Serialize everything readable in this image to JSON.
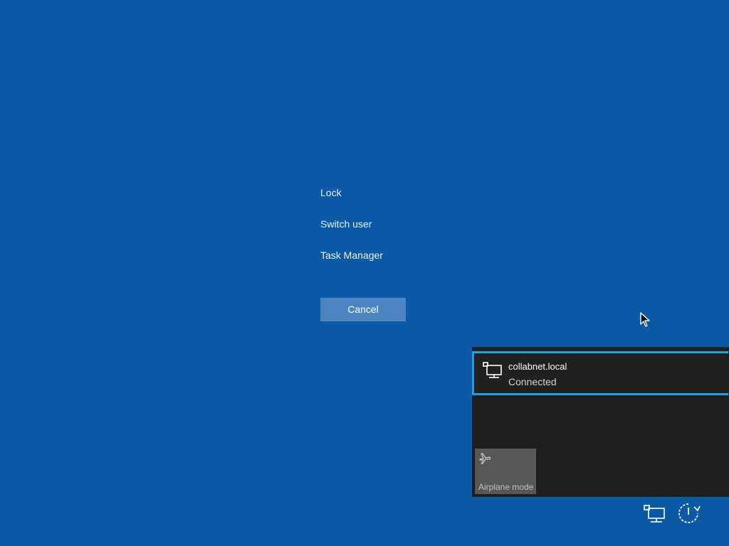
{
  "menu": {
    "items": [
      {
        "label": "Lock"
      },
      {
        "label": "Switch user"
      },
      {
        "label": "Task Manager"
      }
    ],
    "cancel_label": "Cancel"
  },
  "network_flyout": {
    "connection": {
      "name": "collabnet.local",
      "status": "Connected"
    },
    "quick_action": {
      "label": "Airplane mode"
    }
  },
  "icons": {
    "network": "network-icon",
    "airplane": "airplane-icon",
    "power": "power-icon",
    "cursor": "mouse-cursor-icon"
  },
  "colors": {
    "background": "#0a5aa6",
    "button": "#4b86c3",
    "flyout": "#1f1f1f",
    "selection_border": "#1a9fe0",
    "quick_action_tile": "#575757"
  }
}
